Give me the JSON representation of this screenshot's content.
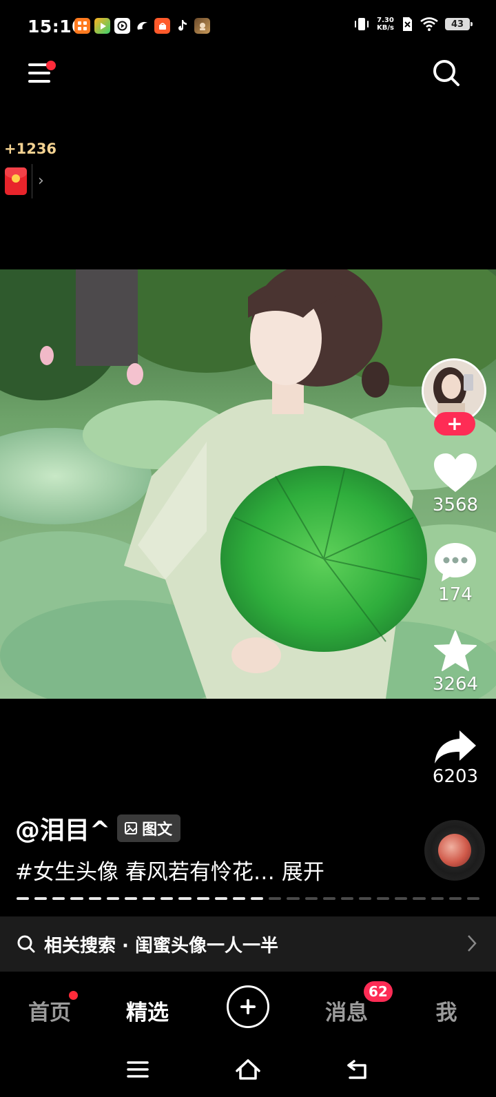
{
  "status_bar": {
    "time": "15:10",
    "net_speed_value": "7.30",
    "net_speed_unit": "KB/s",
    "battery": "43",
    "app_icons": [
      "grid-app-icon",
      "video-app-icon",
      "play-app-icon",
      "swirl-app-icon",
      "shop-app-icon",
      "tiktok-app-icon",
      "game-app-icon"
    ]
  },
  "reward": {
    "count": "+1236",
    "chevron": "›"
  },
  "post": {
    "author": "@泪目^",
    "type_badge": "图文",
    "caption": "#女生头像 春风若有怜花…",
    "expand_label": "展开",
    "progress_total_segments": 26,
    "progress_done_segments": 14
  },
  "actions": {
    "likes": "3568",
    "comments": "174",
    "favorites": "3264",
    "shares": "6203",
    "follow_label": "+"
  },
  "related_search": {
    "text": "相关搜索 · 闺蜜头像一人一半"
  },
  "bottom_nav": {
    "home": "首页",
    "featured": "精选",
    "messages": "消息",
    "messages_badge": "62",
    "me": "我"
  },
  "colors": {
    "accent": "#fe2c55",
    "reward_gold": "#f3d291",
    "background": "#000000"
  }
}
